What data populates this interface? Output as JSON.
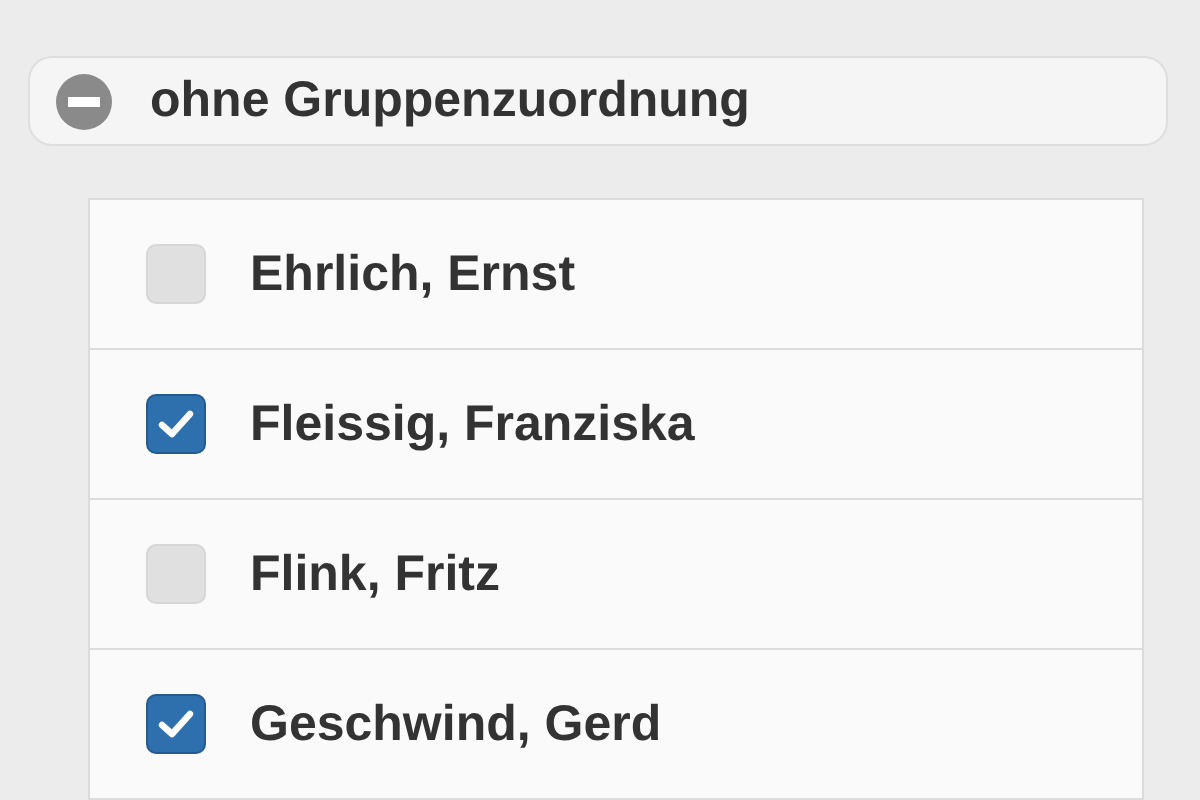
{
  "group": {
    "title": "ohne Gruppenzuordnung",
    "expanded": true
  },
  "members": [
    {
      "name": "Ehrlich, Ernst",
      "checked": false
    },
    {
      "name": "Fleissig, Franziska",
      "checked": true
    },
    {
      "name": "Flink, Fritz",
      "checked": false
    },
    {
      "name": "Geschwind, Gerd",
      "checked": true
    }
  ]
}
